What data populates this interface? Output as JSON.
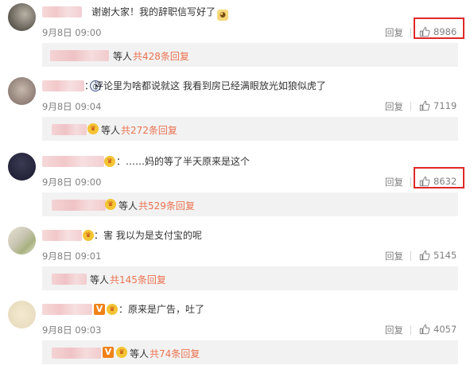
{
  "comments": [
    {
      "text": "谢谢大家！我的辞职信写好了",
      "emoji": "doge-emoji",
      "time": "9月8日 09:00",
      "reply_label": "回复",
      "likes": "8986",
      "highlighted": true,
      "sub_etc": "等人",
      "sub_total": "共428条回复"
    },
    {
      "text": "：评论里为啥都说就这 我看到房已经满眼放光如狼似虎了",
      "time": "9月8日 09:04",
      "reply_label": "回复",
      "likes": "7119",
      "highlighted": false,
      "sub_etc": "等人",
      "sub_total": "共272条回复"
    },
    {
      "text": "：……妈的等了半天原来是这个",
      "time": "9月8日 09:00",
      "reply_label": "回复",
      "likes": "8632",
      "highlighted": true,
      "sub_etc": "等人",
      "sub_total": "共529条回复"
    },
    {
      "text": "：害 我以为是支付宝的呢",
      "time": "9月8日 09:01",
      "reply_label": "回复",
      "likes": "5145",
      "highlighted": false,
      "sub_etc": "等人",
      "sub_total": "共145条回复"
    },
    {
      "text": "：原来是广告，吐了",
      "time": "9月8日 09:03",
      "reply_label": "回复",
      "likes": "4057",
      "highlighted": false,
      "sub_etc": "等人",
      "sub_total": "共74条回复"
    }
  ],
  "badges": {
    "vip_letter": "V"
  },
  "colors": {
    "highlight_border": "#e02828",
    "link_orange": "#eb7350",
    "meta_gray": "#808080",
    "sub_bg": "#f2f2f2"
  },
  "icons": {
    "like": "thumbs-up-icon",
    "medal": "fan-medal-icon",
    "emoji": "doge-emoji-icon"
  }
}
